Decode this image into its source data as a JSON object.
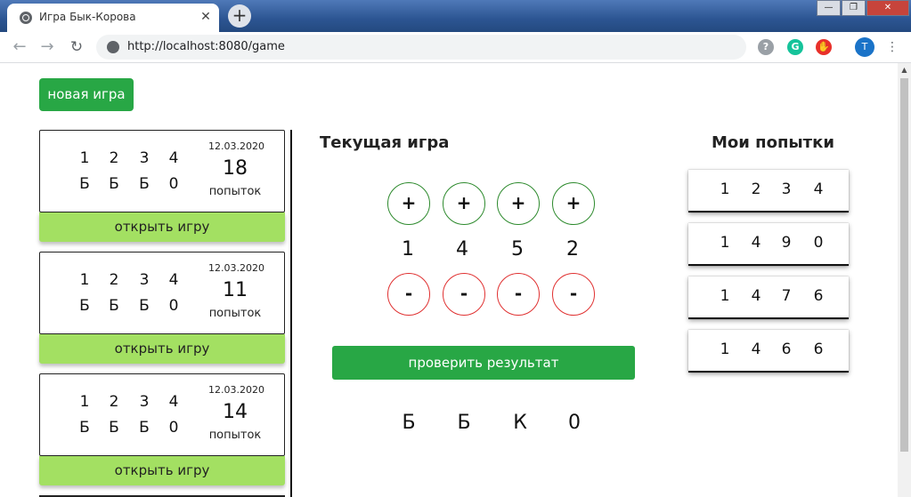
{
  "browser": {
    "tab_title": "Игра Бык-Корова",
    "tab_close": "✕",
    "new_tab": "+",
    "url": "http://localhost:8080/game",
    "profile_initial": "T",
    "window_min": "—",
    "window_max": "❐",
    "window_close": "✕"
  },
  "page": {
    "new_game_label": "новая игра",
    "current_game_title": "Текущая игра",
    "attempts_title": "Мои попытки",
    "plus_label": "+",
    "minus_label": "-",
    "current_digits": [
      "1",
      "4",
      "5",
      "2"
    ],
    "check_label": "проверить результат",
    "result": [
      "Б",
      "Б",
      "К",
      "0"
    ]
  },
  "games": [
    {
      "digits": [
        "1",
        "2",
        "3",
        "4"
      ],
      "result": [
        "Б",
        "Б",
        "Б",
        "0"
      ],
      "date": "12.03.2020",
      "count": "18",
      "count_word": "попыток",
      "open_label": "открыть игру"
    },
    {
      "digits": [
        "1",
        "2",
        "3",
        "4"
      ],
      "result": [
        "Б",
        "Б",
        "Б",
        "0"
      ],
      "date": "12.03.2020",
      "count": "11",
      "count_word": "попыток",
      "open_label": "открыть игру"
    },
    {
      "digits": [
        "1",
        "2",
        "3",
        "4"
      ],
      "result": [
        "Б",
        "Б",
        "Б",
        "0"
      ],
      "date": "12.03.2020",
      "count": "14",
      "count_word": "попыток",
      "open_label": "открыть игру"
    }
  ],
  "attempts": [
    [
      "1",
      "2",
      "3",
      "4"
    ],
    [
      "1",
      "4",
      "9",
      "0"
    ],
    [
      "1",
      "4",
      "7",
      "6"
    ],
    [
      "1",
      "4",
      "6",
      "6"
    ]
  ],
  "colors": {
    "primary_green": "#28a745",
    "light_green": "#a3e062",
    "plus_border": "#2d8a2d",
    "minus_border": "#e03131"
  },
  "icons": {
    "favicon": "globe-icon",
    "back": "arrow-left-icon",
    "forward": "arrow-right-icon",
    "reload": "reload-icon",
    "site_info": "info-icon",
    "ext1": "shield-question-icon",
    "ext2": "grammarly-icon",
    "ext3": "adblock-hand-icon",
    "menu": "kebab-menu-icon"
  }
}
